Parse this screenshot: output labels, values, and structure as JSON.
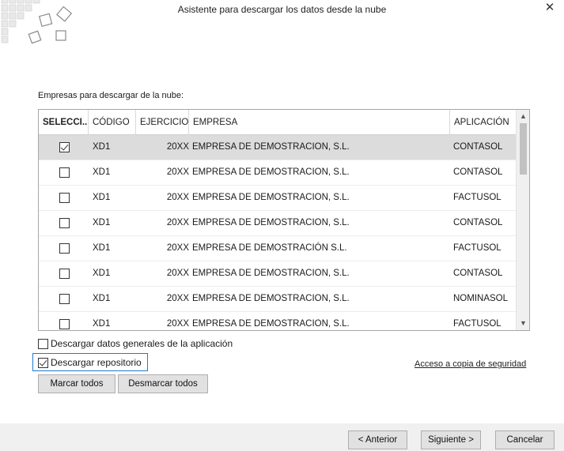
{
  "window": {
    "title": "Asistente para descargar los datos desde la nube",
    "close_glyph": "✕"
  },
  "section_label": "Empresas para descargar de la nube:",
  "table": {
    "columns": [
      "SELECCI...",
      "CÓDIGO",
      "EJERCICIO",
      "EMPRESA",
      "APLICACIÓN"
    ],
    "rows": [
      {
        "selected": true,
        "codigo": "XD1",
        "ejercicio": "20XX",
        "empresa": "EMPRESA DE DEMOSTRACION, S.L.",
        "aplicacion": "CONTASOL"
      },
      {
        "selected": false,
        "codigo": "XD1",
        "ejercicio": "20XX",
        "empresa": "EMPRESA DE DEMOSTRACION, S.L.",
        "aplicacion": "CONTASOL"
      },
      {
        "selected": false,
        "codigo": "XD1",
        "ejercicio": "20XX",
        "empresa": "EMPRESA DE DEMOSTRACION, S.L.",
        "aplicacion": "FACTUSOL"
      },
      {
        "selected": false,
        "codigo": "XD1",
        "ejercicio": "20XX",
        "empresa": "EMPRESA DE DEMOSTRACION, S.L.",
        "aplicacion": "CONTASOL"
      },
      {
        "selected": false,
        "codigo": "XD1",
        "ejercicio": "20XX",
        "empresa": "EMPRESA DE DEMOSTRACIÓN S.L.",
        "aplicacion": "FACTUSOL"
      },
      {
        "selected": false,
        "codigo": "XD1",
        "ejercicio": "20XX",
        "empresa": "EMPRESA DE DEMOSTRACION, S.L.",
        "aplicacion": "CONTASOL"
      },
      {
        "selected": false,
        "codigo": "XD1",
        "ejercicio": "20XX",
        "empresa": "EMPRESA DE DEMOSTRACION, S.L.",
        "aplicacion": "NOMINASOL"
      },
      {
        "selected": false,
        "codigo": "XD1",
        "ejercicio": "20XX",
        "empresa": "EMPRESA DE DEMOSTRACION, S.L.",
        "aplicacion": "FACTUSOL"
      }
    ]
  },
  "options": {
    "general_data": {
      "label": "Descargar datos generales de la aplicación",
      "checked": false
    },
    "repository": {
      "label": "Descargar repositorio",
      "checked": true
    }
  },
  "backup_link": "Acceso a copia de seguridad",
  "buttons": {
    "select_all": "Marcar todos",
    "deselect_all": "Desmarcar todos",
    "back": "< Anterior",
    "next": "Siguiente >",
    "cancel": "Cancelar"
  },
  "colors": {
    "focus": "#1f7bd3",
    "selected_row": "#dcdcdc",
    "footer": "#f0f0f0"
  }
}
